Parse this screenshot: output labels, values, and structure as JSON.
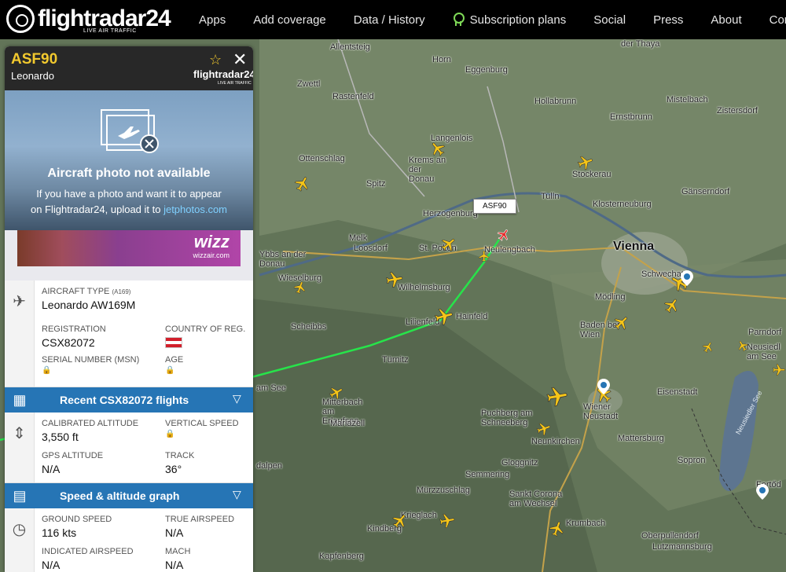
{
  "nav": {
    "logo_text": "flightradar24",
    "logo_sub": "LIVE AIR TRAFFIC",
    "items": [
      "Apps",
      "Add coverage",
      "Data / History",
      "Subscription plans",
      "Social",
      "Press",
      "About",
      "Com"
    ]
  },
  "panel": {
    "callsign": "ASF90",
    "operator": "Leonardo",
    "brand": "flightradar24",
    "brand_sub": "LIVE AIR TRAFFIC",
    "photo": {
      "title": "Aircraft photo not available",
      "text_line1": "If you have a photo and want it to appear",
      "text_line2_prefix": "on Flightradar24, upload it to ",
      "link": "jetphotos.com"
    },
    "ad": {
      "brand": "wizz",
      "url": "wizzair.com"
    },
    "aircraft": {
      "type_label": "AIRCRAFT TYPE",
      "type_code": "(A169)",
      "type_value": "Leonardo AW169M",
      "registration_label": "REGISTRATION",
      "registration_value": "CSX82072",
      "country_label": "COUNTRY OF REG.",
      "serial_label": "SERIAL NUMBER (MSN)",
      "age_label": "AGE"
    },
    "recent_flights_label": "Recent CSX82072 flights",
    "altitude": {
      "calibrated_label": "CALIBRATED ALTITUDE",
      "calibrated_value": "3,550 ft",
      "vertical_label": "VERTICAL SPEED",
      "gps_label": "GPS ALTITUDE",
      "gps_value": "N/A",
      "track_label": "TRACK",
      "track_value": "36°"
    },
    "graph_label": "Speed & altitude graph",
    "speed": {
      "ground_label": "GROUND SPEED",
      "ground_value": "116 kts",
      "true_label": "TRUE AIRSPEED",
      "true_value": "N/A",
      "indicated_label": "INDICATED AIRSPEED",
      "indicated_value": "N/A",
      "mach_label": "MACH",
      "mach_value": "N/A"
    }
  },
  "map": {
    "callout": "ASF90",
    "cities": [
      {
        "name": "Vienna",
        "major": true
      },
      {
        "name": "Allentsteig"
      },
      {
        "name": "Horn"
      },
      {
        "name": "Eggenburg"
      },
      {
        "name": "der Thaya"
      },
      {
        "name": "Zwettl"
      },
      {
        "name": "Rastenfeld"
      },
      {
        "name": "Hollabrunn"
      },
      {
        "name": "Mistelbach"
      },
      {
        "name": "Ernstbrunn"
      },
      {
        "name": "Zistersdorf"
      },
      {
        "name": "Ottenschlag"
      },
      {
        "name": "Langenlois"
      },
      {
        "name": "Krems an der Donau"
      },
      {
        "name": "Stockerau"
      },
      {
        "name": "Spitz"
      },
      {
        "name": "Tulln"
      },
      {
        "name": "Gänserndorf"
      },
      {
        "name": "Herzogenburg"
      },
      {
        "name": "Klosterneuburg"
      },
      {
        "name": "Melk"
      },
      {
        "name": "Loosdorf"
      },
      {
        "name": "St. Pölten"
      },
      {
        "name": "Neulengbach"
      },
      {
        "name": "Ybbs an der Donau"
      },
      {
        "name": "Wieselburg"
      },
      {
        "name": "Wilhelmsburg"
      },
      {
        "name": "Schwechat"
      },
      {
        "name": "Mödling"
      },
      {
        "name": "Lilienfeld"
      },
      {
        "name": "Hainfeld"
      },
      {
        "name": "Baden bei Wien"
      },
      {
        "name": "Scheibbs"
      },
      {
        "name": "Parndorf"
      },
      {
        "name": "Neusiedl am See"
      },
      {
        "name": "Türnitz"
      },
      {
        "name": "Eisenstadt"
      },
      {
        "name": "Neusiedler See"
      },
      {
        "name": "Mitterbach am Erlaufsee"
      },
      {
        "name": "Mariazell"
      },
      {
        "name": "Puchberg am Schneeberg"
      },
      {
        "name": "Wiener Neustadt"
      },
      {
        "name": "Neunkirchen"
      },
      {
        "name": "Mattersburg"
      },
      {
        "name": "Gloggnitz"
      },
      {
        "name": "Sopron"
      },
      {
        "name": "Semmering"
      },
      {
        "name": "Mürzzuschlag"
      },
      {
        "name": "Sankt Corona am Wechsel"
      },
      {
        "name": "Fertőd"
      },
      {
        "name": "Krieglach"
      },
      {
        "name": "Kindberg"
      },
      {
        "name": "Krumbach"
      },
      {
        "name": "Oberpullendorf"
      },
      {
        "name": "Lutzmannsburg"
      },
      {
        "name": "Kapfenberg"
      },
      {
        "name": "am See"
      },
      {
        "name": "dalpen"
      }
    ]
  }
}
